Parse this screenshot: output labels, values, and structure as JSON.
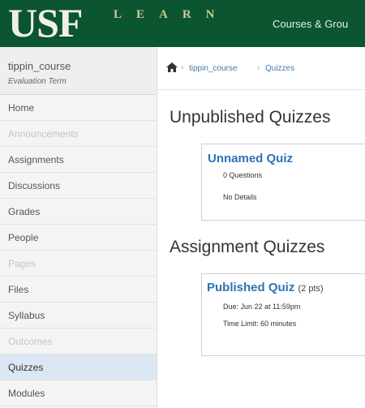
{
  "header": {
    "logo_main": "USF",
    "logo_sub": "LEARN",
    "nav_label": "Courses & Grou",
    "colors": {
      "header_bg": "#0b5531",
      "logo_text": "#f2f0e6",
      "logo_sub": "#d2c796"
    }
  },
  "sidebar": {
    "course_name": "tippin_course",
    "course_term": "Evaluation Term",
    "items": [
      {
        "label": "Home",
        "state": "enabled"
      },
      {
        "label": "Announcements",
        "state": "disabled"
      },
      {
        "label": "Assignments",
        "state": "enabled"
      },
      {
        "label": "Discussions",
        "state": "enabled"
      },
      {
        "label": "Grades",
        "state": "enabled"
      },
      {
        "label": "People",
        "state": "enabled"
      },
      {
        "label": "Pages",
        "state": "disabled"
      },
      {
        "label": "Files",
        "state": "enabled"
      },
      {
        "label": "Syllabus",
        "state": "enabled"
      },
      {
        "label": "Outcomes",
        "state": "disabled"
      },
      {
        "label": "Quizzes",
        "state": "active"
      },
      {
        "label": "Modules",
        "state": "enabled"
      }
    ]
  },
  "breadcrumb": {
    "home_icon": "home-icon",
    "items": [
      "tippin_course",
      "Quizzes"
    ],
    "separator": "›"
  },
  "main": {
    "unpublished": {
      "title": "Unpublished Quizzes",
      "quiz": {
        "name": "Unnamed Quiz",
        "questions": "0 Questions",
        "details": "No Details"
      }
    },
    "assignment": {
      "title": "Assignment Quizzes",
      "quiz": {
        "name": "Published Quiz",
        "points": "(2 pts)",
        "due": "Due: Jun 22 at 11:59pm",
        "time_limit": "Time Limit: 60 minutes"
      }
    },
    "colors": {
      "link": "#2c73b6",
      "active_nav": "#dbe7f3"
    }
  }
}
